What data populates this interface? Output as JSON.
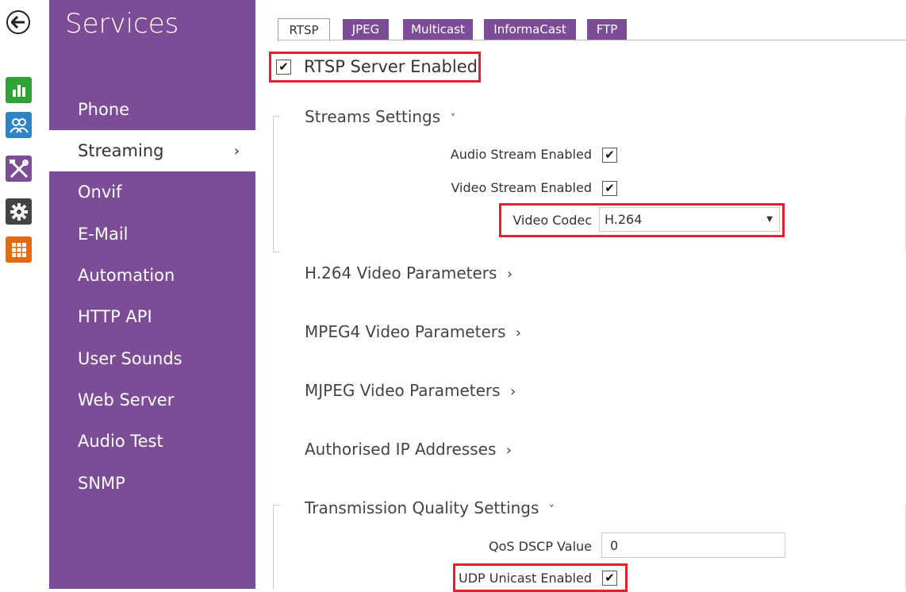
{
  "rail": {
    "icons": [
      {
        "name": "status-icon",
        "color": "#2fa334"
      },
      {
        "name": "directory-icon",
        "color": "#2d84c6"
      },
      {
        "name": "hardware-tools-icon",
        "color": "#7c4d96"
      },
      {
        "name": "services-gear-icon",
        "color": "#444444"
      },
      {
        "name": "system-grid-icon",
        "color": "#e8680f"
      }
    ]
  },
  "sidebar": {
    "title": "Services",
    "items": [
      {
        "label": "Phone"
      },
      {
        "label": "Streaming",
        "active": true,
        "chevron": "›"
      },
      {
        "label": "Onvif"
      },
      {
        "label": "E-Mail"
      },
      {
        "label": "Automation"
      },
      {
        "label": "HTTP API"
      },
      {
        "label": "User Sounds"
      },
      {
        "label": "Web Server"
      },
      {
        "label": "Audio Test"
      },
      {
        "label": "SNMP"
      }
    ]
  },
  "tabs": [
    {
      "label": "RTSP",
      "active": true
    },
    {
      "label": "JPEG"
    },
    {
      "label": "Multicast"
    },
    {
      "label": "InformaCast"
    },
    {
      "label": "FTP"
    }
  ],
  "rtsp_server": {
    "label": "RTSP Server Enabled",
    "checked": true
  },
  "streams": {
    "title": "Streams Settings",
    "chevron": "˅",
    "audio_label": "Audio Stream Enabled",
    "audio_checked": true,
    "video_label": "Video Stream Enabled",
    "video_checked": true,
    "codec_label": "Video Codec",
    "codec_value": "H.264"
  },
  "sections": [
    {
      "title": "H.264 Video Parameters",
      "chevron": "›"
    },
    {
      "title": "MPEG4 Video Parameters",
      "chevron": "›"
    },
    {
      "title": "MJPEG Video Parameters",
      "chevron": "›"
    },
    {
      "title": "Authorised IP Addresses",
      "chevron": "›"
    }
  ],
  "transmission": {
    "title": "Transmission Quality Settings",
    "chevron": "˅",
    "qos_label": "QoS DSCP Value",
    "qos_value": "0",
    "udp_label": "UDP Unicast Enabled",
    "udp_checked": true
  },
  "colors": {
    "accent": "#7c4d96",
    "highlight": "#e5202a"
  }
}
